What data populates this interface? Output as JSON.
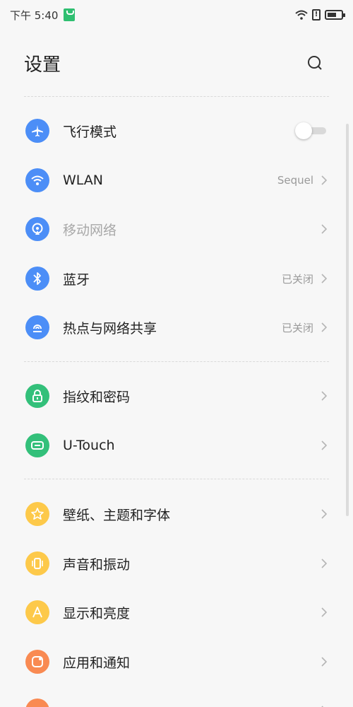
{
  "status_bar": {
    "time": "下午 5:40"
  },
  "header": {
    "title": "设置"
  },
  "colors": {
    "blue": "#4c8ef7",
    "green": "#33c07a",
    "yellow": "#fdc94a",
    "orange": "#f98a52"
  },
  "rows": [
    {
      "label": "飞行模式",
      "icon": "airplane-icon",
      "toggle": "off"
    },
    {
      "label": "WLAN",
      "icon": "wifi-icon",
      "value": "Sequel"
    },
    {
      "label": "移动网络",
      "icon": "mobile-network-icon",
      "disabled": true
    },
    {
      "label": "蓝牙",
      "icon": "bluetooth-icon",
      "value": "已关闭"
    },
    {
      "label": "热点与网络共享",
      "icon": "hotspot-icon",
      "value": "已关闭"
    },
    {
      "label": "指纹和密码",
      "icon": "lock-icon"
    },
    {
      "label": "U-Touch",
      "icon": "utouch-icon"
    },
    {
      "label": "壁纸、主题和字体",
      "icon": "star-icon"
    },
    {
      "label": "声音和振动",
      "icon": "vibrate-icon"
    },
    {
      "label": "显示和亮度",
      "icon": "display-icon"
    },
    {
      "label": "应用和通知",
      "icon": "apps-icon"
    }
  ]
}
